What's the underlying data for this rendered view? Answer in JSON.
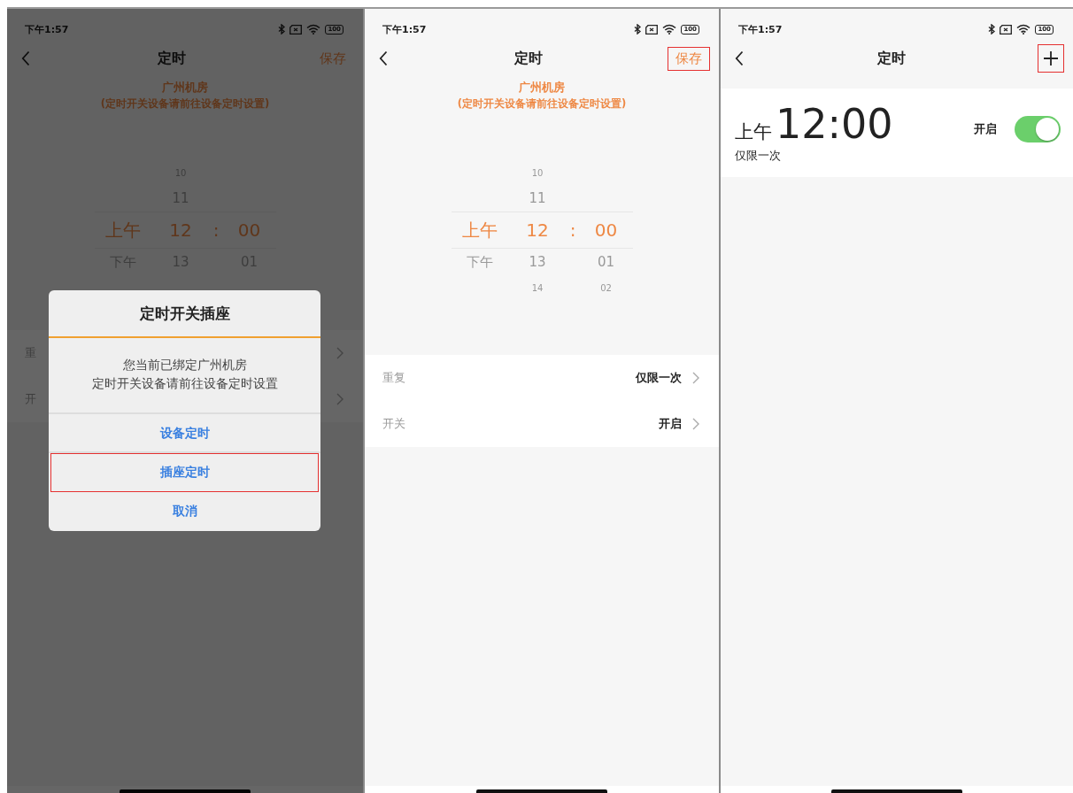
{
  "screens": [
    {
      "dimmed": true,
      "status": {
        "time": "下午1:57",
        "battery": "100"
      },
      "nav": {
        "title": "定时",
        "action": {
          "kind": "text",
          "label": "保存",
          "highlighted": false
        }
      },
      "location": "广州机房",
      "note": "(定时开关设备请前往设备定时设置)",
      "picker": [
        {
          "kind": "far",
          "hour": "10",
          "selected": false
        },
        {
          "kind": "near",
          "hour": "11",
          "selected": false
        },
        {
          "kind": "center",
          "period": "上午",
          "hour": "12",
          "sep": ":",
          "minute": "00",
          "selected": true
        },
        {
          "kind": "near",
          "period": "下午",
          "hour": "13",
          "minute": "01",
          "selected": false
        }
      ],
      "settings": [
        {
          "label": "重"
        },
        {
          "label": "开"
        }
      ],
      "dialog": {
        "title": "定时开关插座",
        "message": [
          "您当前已绑定广州机房",
          "定时开关设备请前往设备定时设置"
        ],
        "buttons": [
          {
            "label": "设备定时",
            "highlighted": false
          },
          {
            "label": "插座定时",
            "highlighted": true
          },
          {
            "label": "取消",
            "highlighted": false
          }
        ]
      }
    },
    {
      "status": {
        "time": "下午1:57",
        "battery": "100"
      },
      "nav": {
        "title": "定时",
        "action": {
          "kind": "text",
          "label": "保存",
          "highlighted": true
        }
      },
      "location": "广州机房",
      "note": "(定时开关设备请前往设备定时设置)",
      "picker": [
        {
          "kind": "far",
          "hour": "10",
          "selected": false
        },
        {
          "kind": "near",
          "hour": "11",
          "selected": false
        },
        {
          "kind": "center",
          "period": "上午",
          "hour": "12",
          "sep": ":",
          "minute": "00",
          "selected": true
        },
        {
          "kind": "near",
          "period": "下午",
          "hour": "13",
          "minute": "01",
          "selected": false
        },
        {
          "kind": "far",
          "hour": "14",
          "minute": "02",
          "selected": false
        }
      ],
      "settings": [
        {
          "label": "重复",
          "value": "仅限一次"
        },
        {
          "label": "开关",
          "value": "开启"
        }
      ]
    },
    {
      "status": {
        "time": "下午1:57",
        "battery": "100"
      },
      "nav": {
        "title": "定时",
        "action": {
          "kind": "plus",
          "highlighted": true
        }
      },
      "timers": [
        {
          "period": "上午",
          "time": "12:00",
          "repeat": "仅限一次",
          "state_label": "开启",
          "on": true
        }
      ]
    }
  ]
}
